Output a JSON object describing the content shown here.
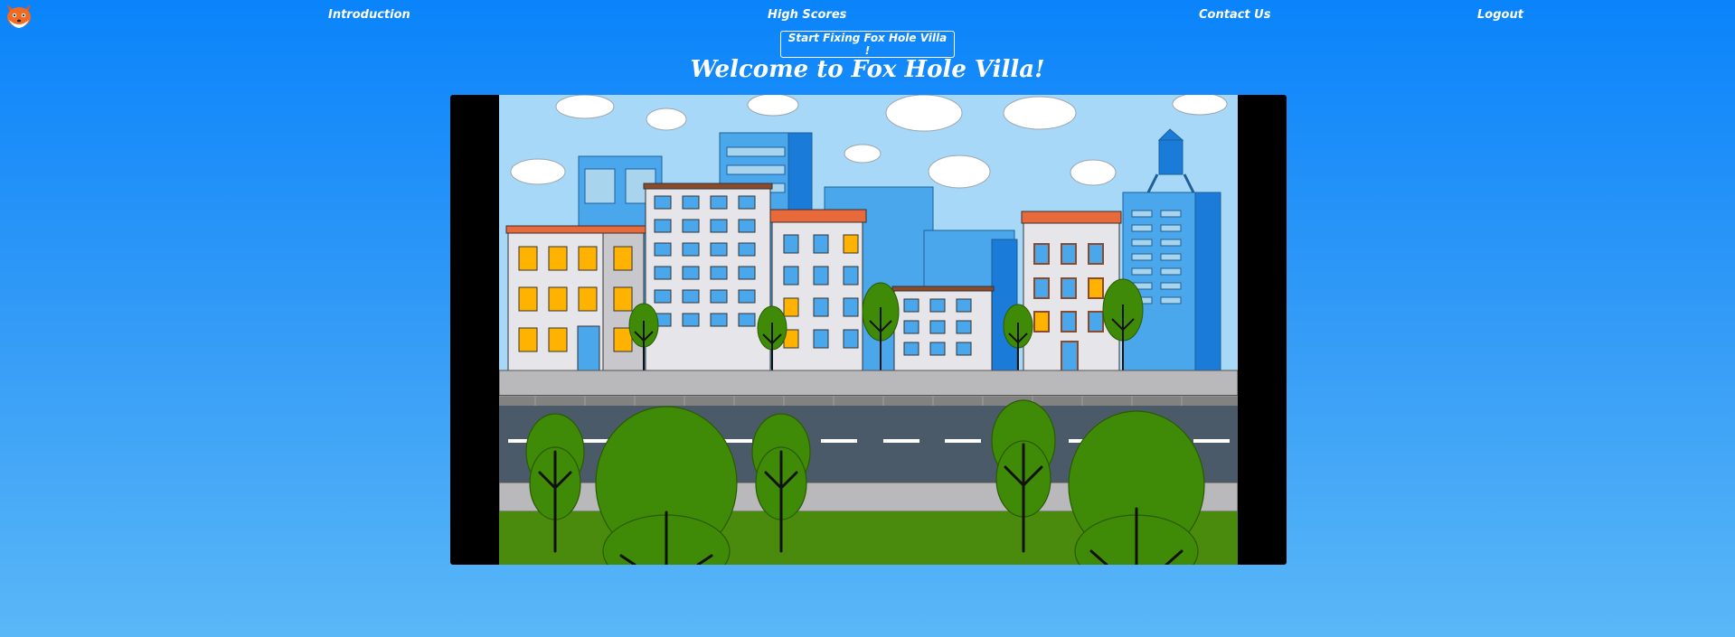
{
  "nav": {
    "introduction": "Introduction",
    "high_scores": "High Scores",
    "contact_us": "Contact Us",
    "logout": "Logout"
  },
  "start_button": "Start Fixing Fox Hole Villa !",
  "title": "Welcome to Fox Hole Villa!",
  "icons": {
    "logo": "fox-logo-icon"
  },
  "colors": {
    "background_top": "#0a84fb",
    "background_bottom": "#5ab7f7",
    "sky": "#a8d8f7",
    "grass": "#4a8a0c",
    "road": "#4a5a68",
    "tree": "#3f8a06",
    "window_yellow": "#ffb300",
    "roof_orange": "#e8693a"
  }
}
